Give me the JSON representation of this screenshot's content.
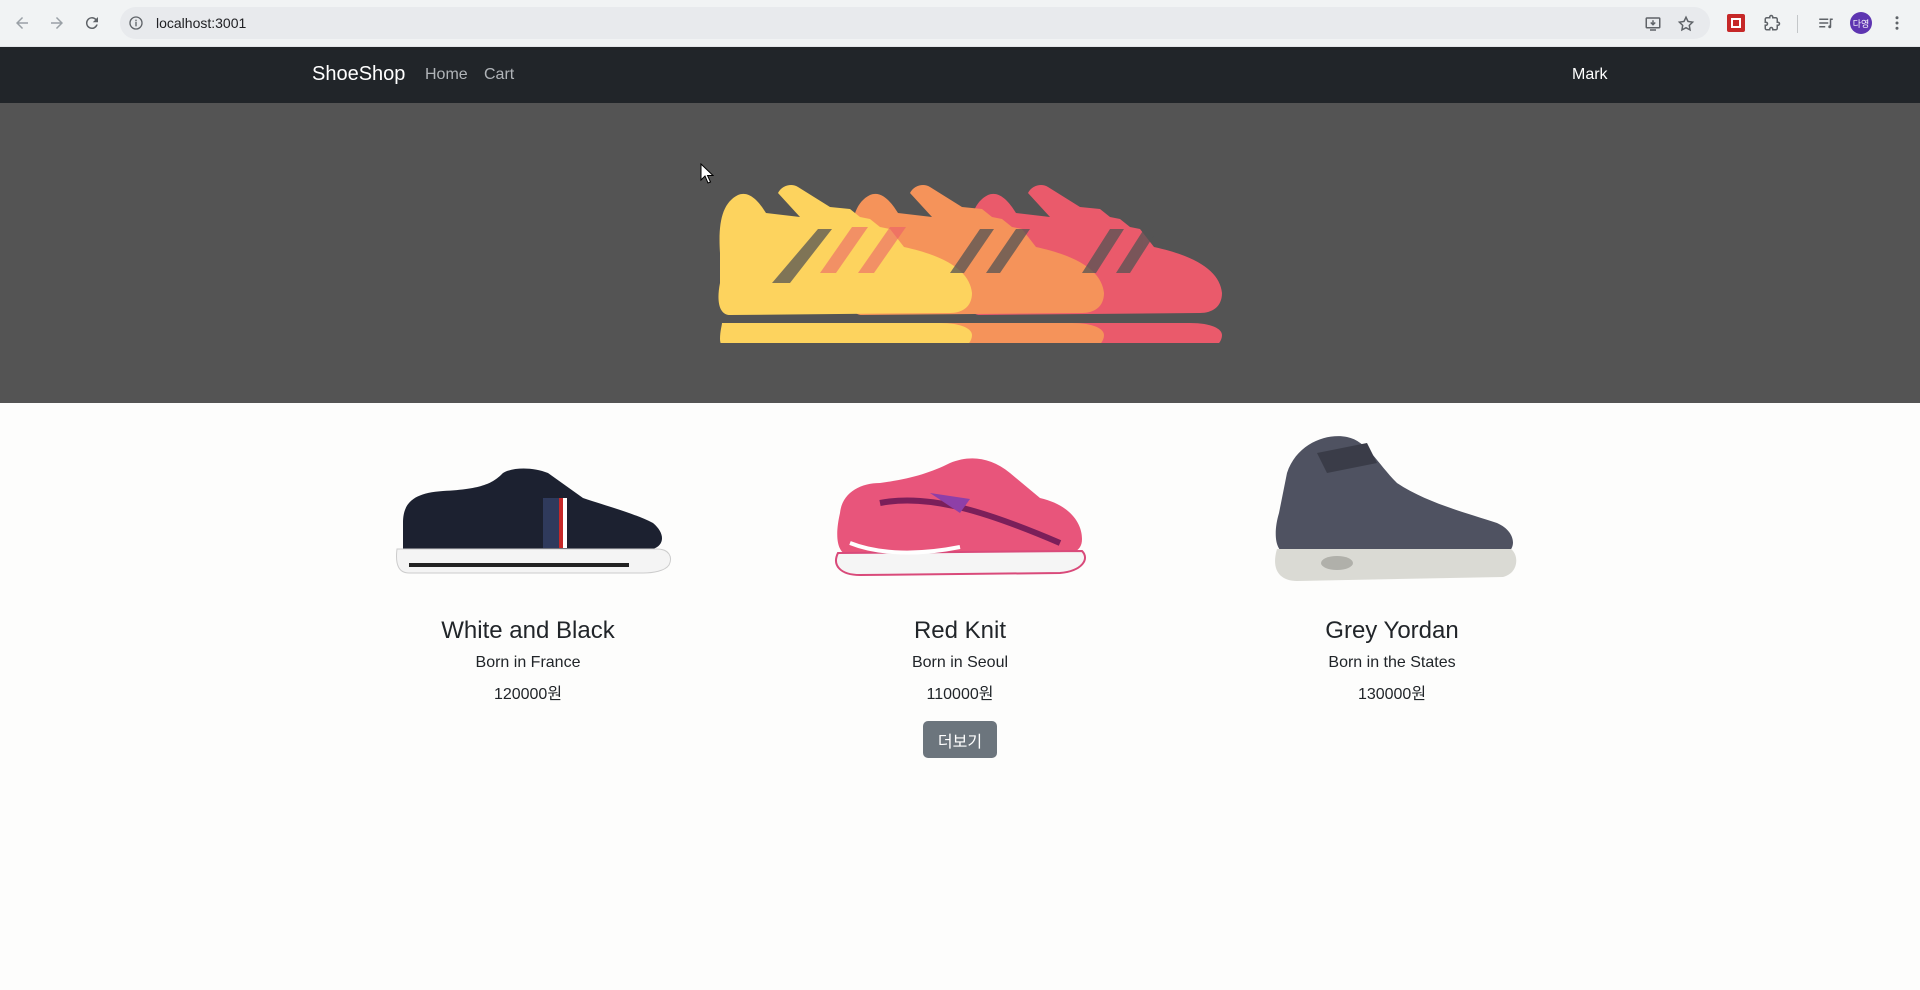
{
  "browser": {
    "url": "localhost:3001",
    "profile_initials": "다영"
  },
  "navbar": {
    "brand": "ShoeShop",
    "links": [
      "Home",
      "Cart"
    ],
    "user": "Mark"
  },
  "colors": {
    "navbar_bg": "#212529",
    "hero_bg": "#545454",
    "button_bg": "#6c757d",
    "shoe_yellow": "#fdd35e",
    "shoe_orange": "#f5935a",
    "shoe_red": "#ea5a6b"
  },
  "products": [
    {
      "title": "White and Black",
      "origin": "Born in France",
      "price": "120000원",
      "image": "black-sneaker"
    },
    {
      "title": "Red Knit",
      "origin": "Born in Seoul",
      "price": "110000원",
      "image": "pink-running-shoe"
    },
    {
      "title": "Grey Yordan",
      "origin": "Born in the States",
      "price": "130000원",
      "image": "grey-high-top"
    }
  ],
  "more_button": "더보기"
}
